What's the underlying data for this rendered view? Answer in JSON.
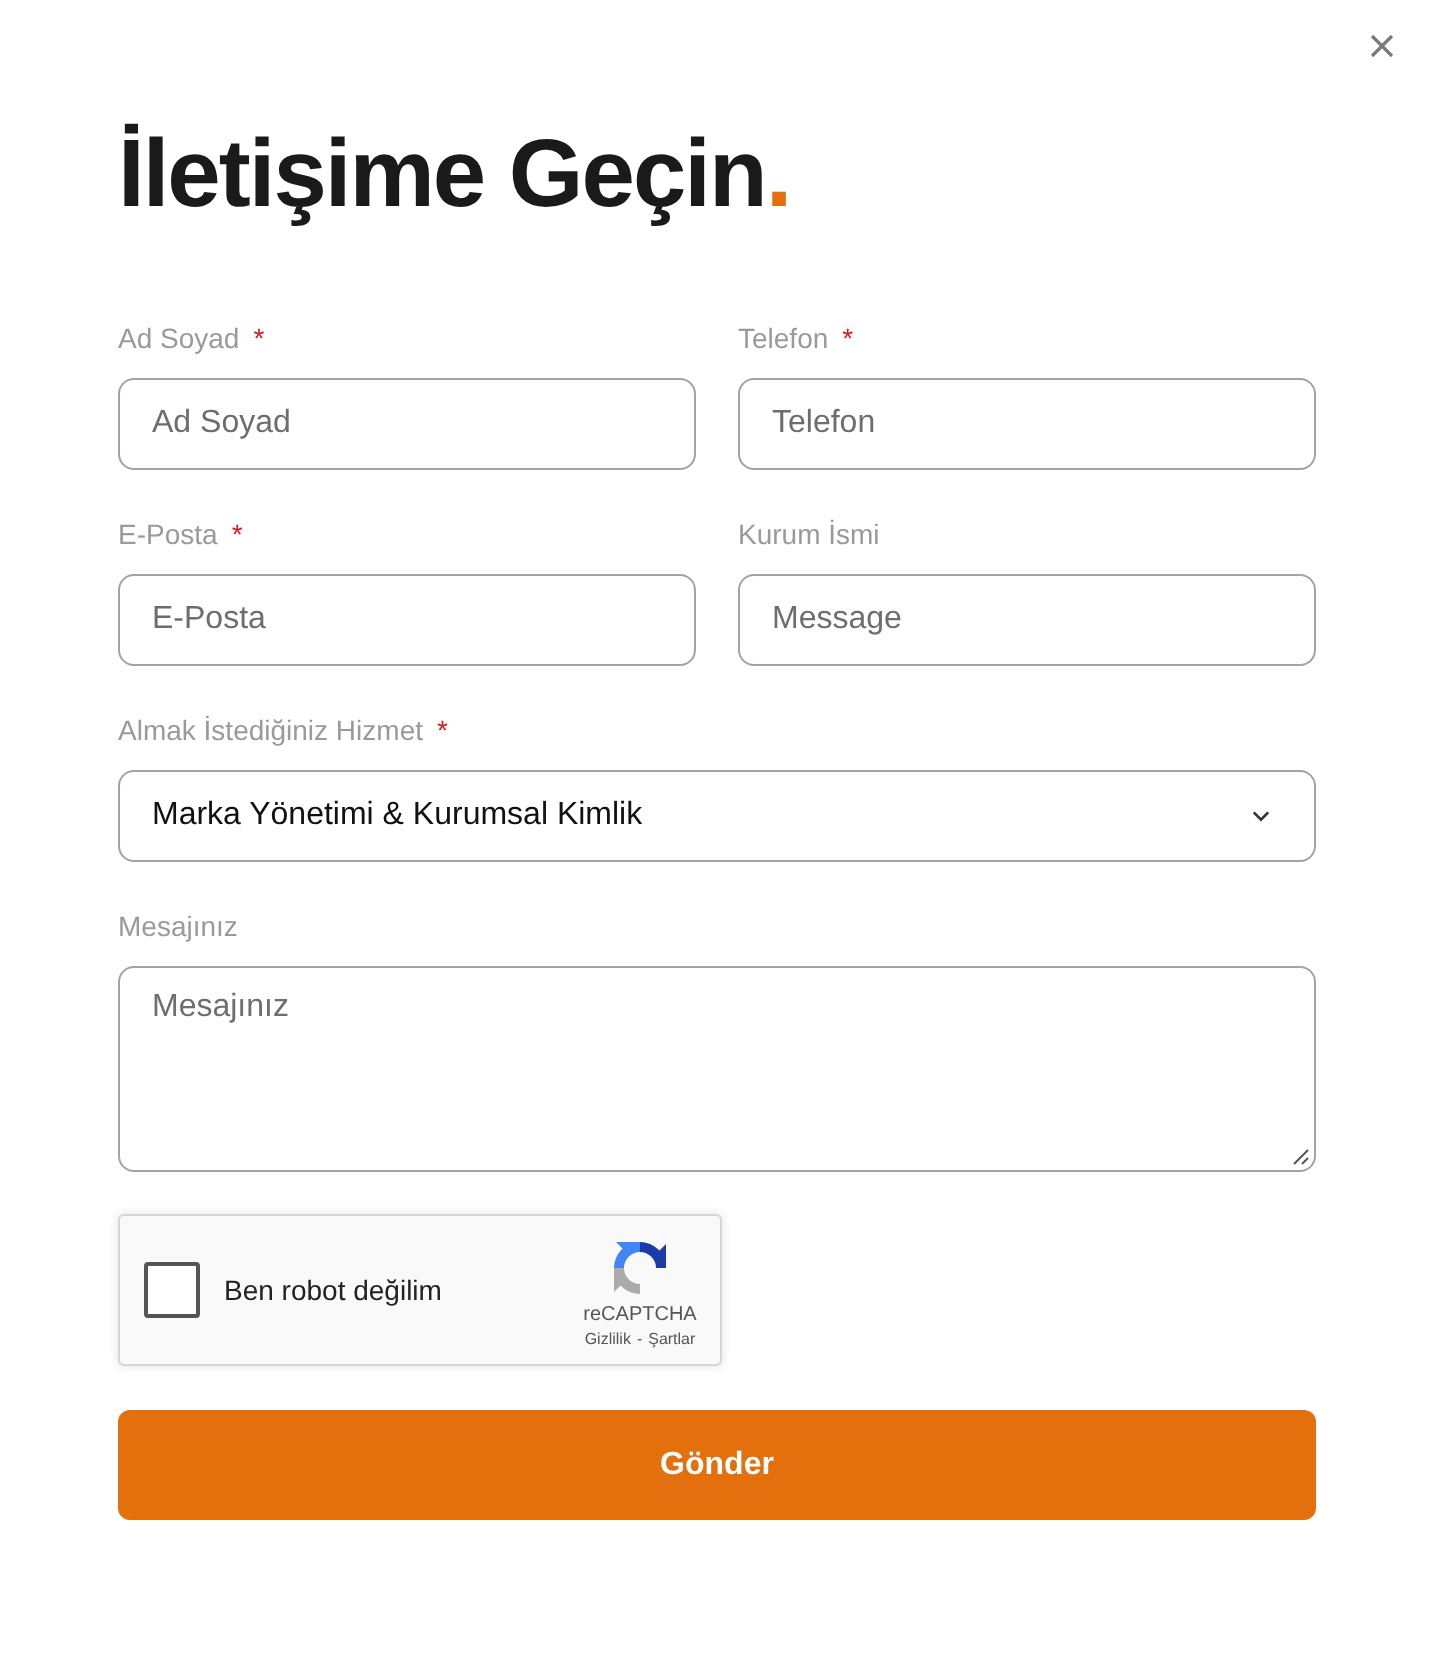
{
  "heading": {
    "text": "İletişime Geçin",
    "accent": "."
  },
  "required_mark": "*",
  "fields": [
    {
      "kind": "input",
      "label": "Ad Soyad",
      "required": true,
      "placeholder": "Ad Soyad"
    },
    {
      "kind": "input",
      "label": "Telefon",
      "required": true,
      "placeholder": "Telefon"
    },
    {
      "kind": "input",
      "label": "E-Posta",
      "required": true,
      "placeholder": "E-Posta"
    },
    {
      "kind": "input",
      "label": "Kurum İsmi",
      "required": false,
      "placeholder": "Message"
    },
    {
      "kind": "select",
      "label": "Almak İstediğiniz Hizmet",
      "required": true,
      "value": "Marka Yönetimi & Kurumsal Kimlik"
    },
    {
      "kind": "textarea",
      "label": "Mesajınız",
      "required": false,
      "placeholder": "Mesajınız"
    }
  ],
  "captcha": {
    "checked": false,
    "label": "Ben robot değilim",
    "brand": "reCAPTCHA",
    "privacy_link": "Gizlilik",
    "separator": "-",
    "terms_link": "Şartlar"
  },
  "submit_button": "Gönder"
}
